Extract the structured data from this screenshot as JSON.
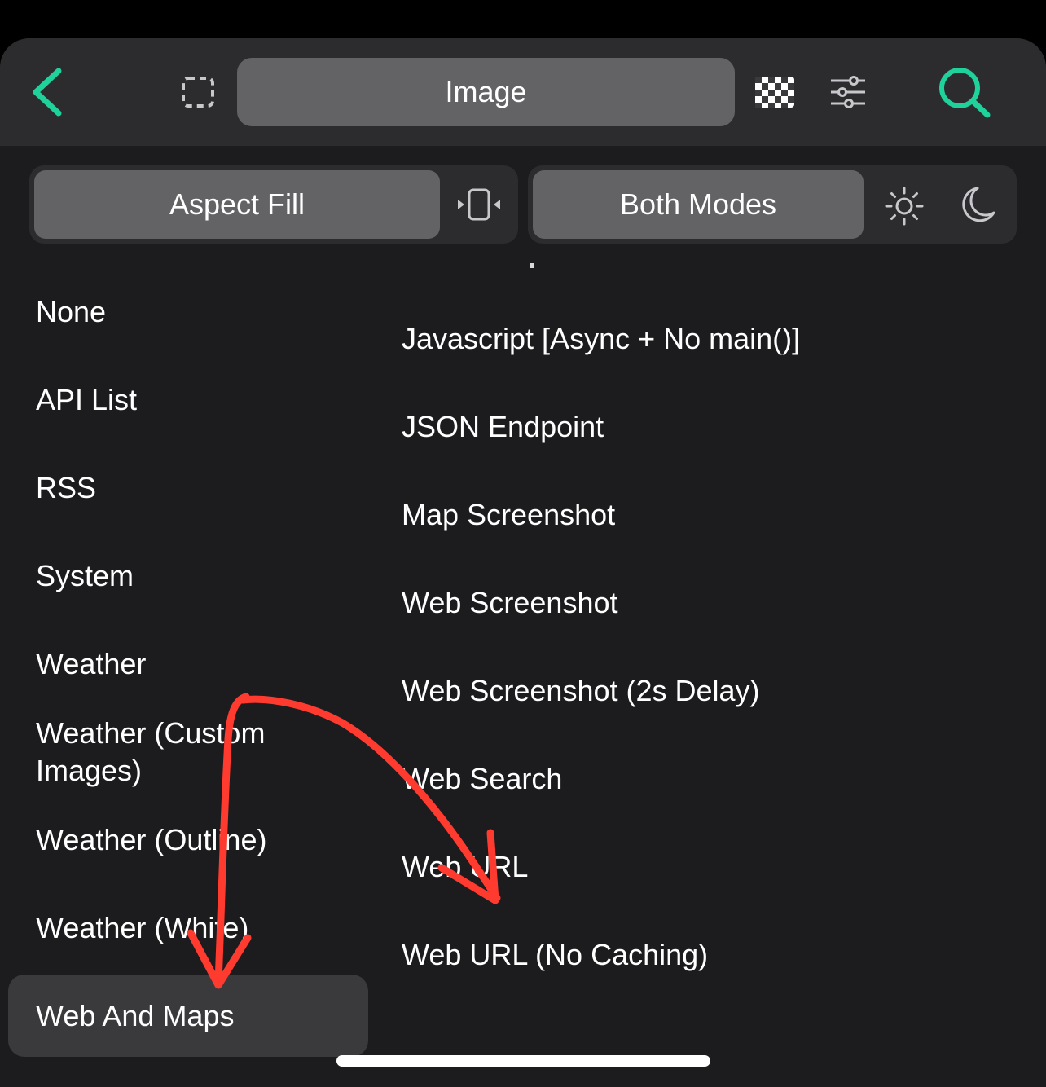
{
  "toolbar": {
    "back_icon": "chevron-left-icon",
    "frame_icon": "dashed-square-icon",
    "title": "Image",
    "grid_icon": "checkerboard-icon",
    "sliders_icon": "sliders-icon",
    "search_icon": "search-icon",
    "accent_color": "#1fd19a"
  },
  "content_mode": {
    "label": "Aspect Fill",
    "icon": "fit-width-icon"
  },
  "appearance": {
    "label": "Both Modes",
    "light_icon": "sun-icon",
    "dark_icon": "moon-icon"
  },
  "categories": [
    "None",
    "API List",
    "RSS",
    "System",
    "Weather",
    "Weather (Custom",
    "Images)",
    "Weather (Outline)",
    "Weather (White)",
    "Web And Maps"
  ],
  "selected_category": "Web And Maps",
  "sources": [
    "Javascript [Async + No main()]",
    "JSON Endpoint",
    "Map Screenshot",
    "Web Screenshot",
    "Web Screenshot (2s Delay)",
    "Web Search",
    "Web URL",
    "Web URL (No Caching)"
  ],
  "annotation_color": "#ff3b30"
}
